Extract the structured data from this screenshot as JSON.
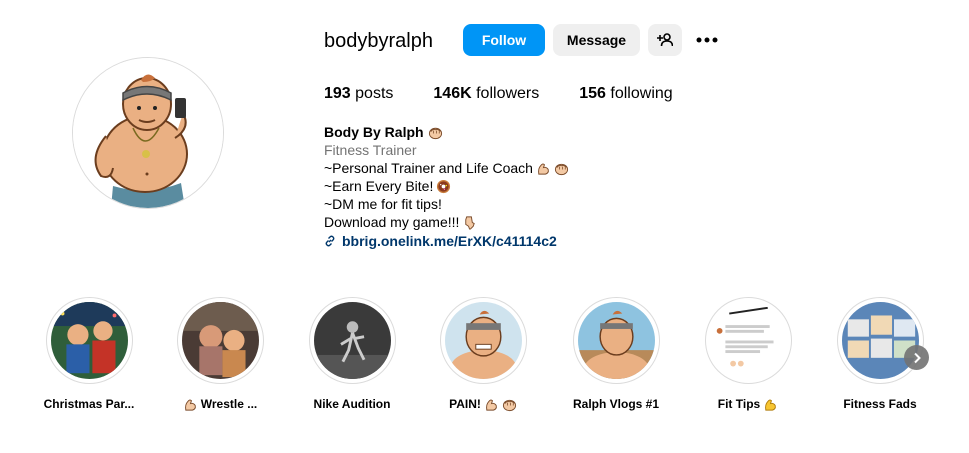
{
  "profile": {
    "username": "bodybyralph",
    "follow_label": "Follow",
    "message_label": "Message",
    "posts_count": "193",
    "posts_label": "posts",
    "followers_count": "146K",
    "followers_label": "followers",
    "following_count": "156",
    "following_label": "following",
    "display_name": "Body By Ralph",
    "category": "Fitness Trainer",
    "bio_lines": [
      "~Personal Trainer and Life Coach",
      "~Earn Every Bite!",
      "~DM me for fit tips!",
      "Download my game!!!"
    ],
    "link": "bbrig.onelink.me/ErXK/c41114c2"
  },
  "highlights": [
    {
      "label": "Christmas Par...",
      "icon": "christmas-party-cover"
    },
    {
      "label": "Wrestle ...",
      "icon": "wrestle-cover"
    },
    {
      "label": "Nike Audition",
      "icon": "nike-audition-cover"
    },
    {
      "label": "PAIN!",
      "icon": "pain-cover"
    },
    {
      "label": "Ralph Vlogs #1",
      "icon": "ralph-vlogs-cover"
    },
    {
      "label": "Fit Tips",
      "icon": "fit-tips-cover"
    },
    {
      "label": "Fitness Fads",
      "icon": "fitness-fads-cover"
    }
  ],
  "colors": {
    "accent": "#0095f6",
    "secondary_button": "#efefef",
    "link": "#00376b",
    "muted_text": "#737373"
  }
}
